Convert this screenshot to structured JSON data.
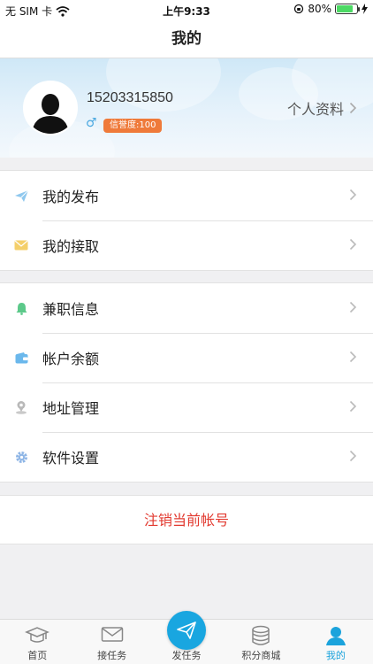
{
  "status_bar": {
    "carrier": "无 SIM 卡",
    "time": "上午9:33",
    "battery": "80%",
    "battery_level": 0.8
  },
  "header": {
    "title": "我的"
  },
  "profile": {
    "phone": "15203315850",
    "gender_symbol": "♂",
    "credit": "信誉度:100",
    "link_label": "个人资料"
  },
  "menu_group1": [
    {
      "label": "我的发布",
      "icon": "paper-plane-icon"
    },
    {
      "label": "我的接取",
      "icon": "envelope-icon"
    }
  ],
  "menu_group2": [
    {
      "label": "兼职信息",
      "icon": "bell-icon"
    },
    {
      "label": "帐户余额",
      "icon": "wallet-icon"
    },
    {
      "label": "地址管理",
      "icon": "location-pin-icon"
    },
    {
      "label": "软件设置",
      "icon": "gear-icon"
    }
  ],
  "logout": {
    "label": "注销当前帐号"
  },
  "tabbar": [
    {
      "label": "首页",
      "icon": "graduation-cap-icon"
    },
    {
      "label": "接任务",
      "icon": "envelope-icon"
    },
    {
      "label": "发任务",
      "icon": "paper-plane-icon"
    },
    {
      "label": "积分商城",
      "icon": "coins-stack-icon"
    },
    {
      "label": "我的",
      "icon": "user-icon"
    }
  ],
  "colors": {
    "accent": "#1ba3dc",
    "danger": "#e23a30",
    "badge": "#ef7a3a"
  }
}
